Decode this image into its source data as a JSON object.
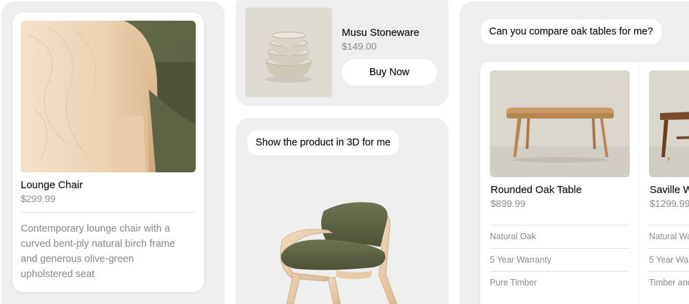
{
  "lounge_card": {
    "title": "Lounge Chair",
    "price": "$299.99",
    "description_lines": [
      "Contemporary lounge chair with a",
      "curved bent-ply natural birch frame",
      "and generous olive-green",
      "upholstered seat"
    ]
  },
  "stoneware_card": {
    "title": "Musu Stoneware",
    "price": "$149.00",
    "buy_label": "Buy Now"
  },
  "chat_3d": {
    "prompt": "Show the product in 3D for me"
  },
  "chat_compare": {
    "prompt": "Can you compare oak tables for me?",
    "tables": [
      {
        "title": "Rounded Oak Table",
        "price": "$899.99",
        "specs": [
          "Natural Oak",
          "5 Year Warranty",
          "Pure Timber"
        ]
      },
      {
        "title": "Saville W",
        "price": "$1299.99",
        "specs": [
          "Natural Wa",
          "5 Year War",
          "Timber and"
        ]
      }
    ]
  },
  "colors": {
    "panel_bg": "#efefef",
    "card_bg": "#ffffff",
    "olive_fabric": "#6b6f4f",
    "birch_wood": "#e9cfae"
  }
}
